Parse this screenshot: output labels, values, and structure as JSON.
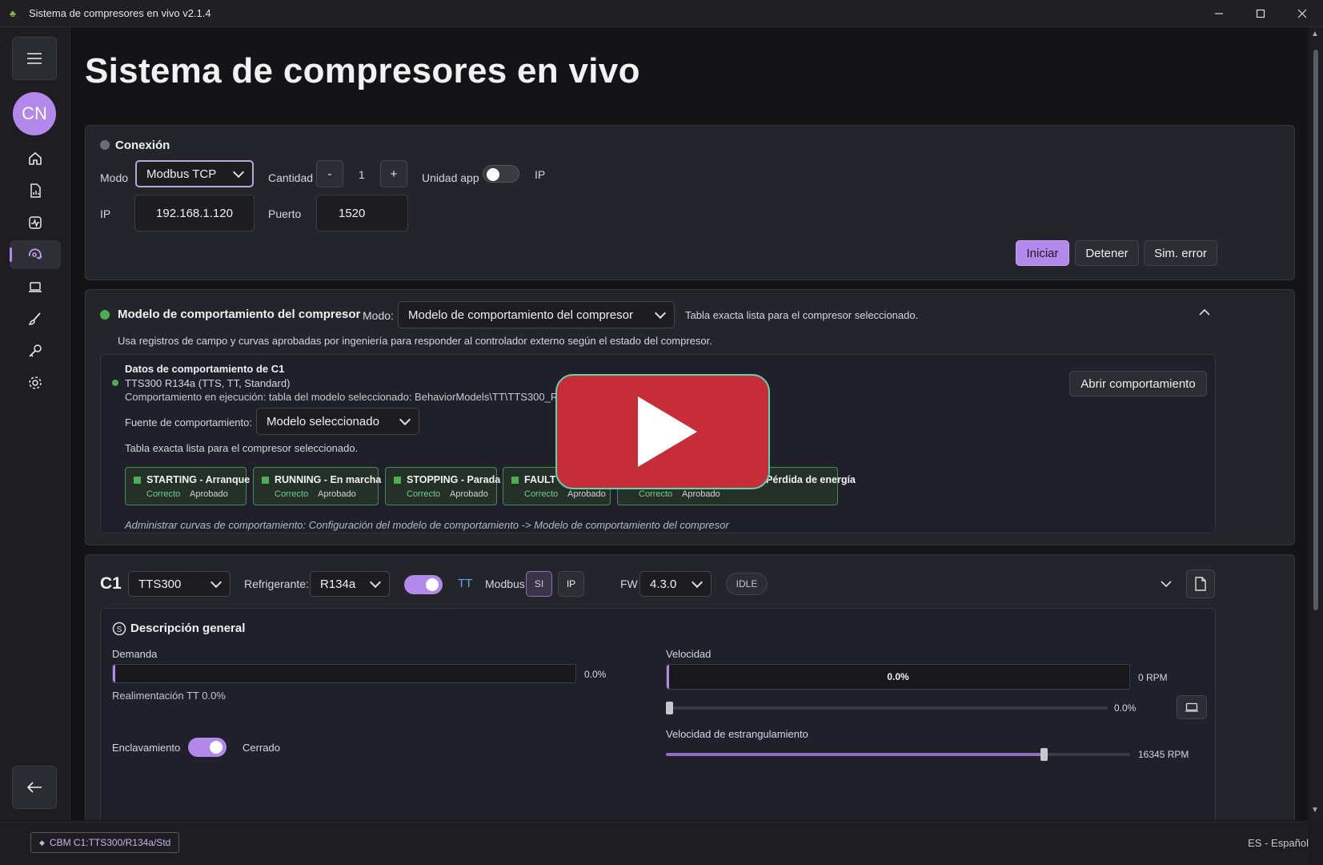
{
  "window": {
    "title": "Sistema de compresores en vivo v2.1.4"
  },
  "sidebar": {
    "avatar_initials": "CN",
    "items": [
      {
        "icon": "home-icon"
      },
      {
        "icon": "report-icon"
      },
      {
        "icon": "activity-icon"
      },
      {
        "icon": "compressor-icon",
        "active": true
      },
      {
        "icon": "laptop-icon"
      },
      {
        "icon": "brush-icon"
      },
      {
        "icon": "key-icon"
      },
      {
        "icon": "gear-icon"
      }
    ]
  },
  "page": {
    "title": "Sistema de compresores en vivo"
  },
  "connection": {
    "header": "Conexión",
    "mode_label": "Modo",
    "mode_value": "Modbus TCP",
    "quantity_label": "Cantidad",
    "quantity_minus": "-",
    "quantity_value": "1",
    "quantity_plus": "+",
    "unit_app_label": "Unidad app",
    "ip_toggle_label": "IP",
    "ip_label": "IP",
    "ip_value": "192.168.1.120",
    "port_label": "Puerto",
    "port_value": "1520",
    "start_button": "Iniciar",
    "stop_button": "Detener",
    "sim_error_button": "Sim. error",
    "status_color": "#6b6b70"
  },
  "behavior": {
    "header": "Modelo de comportamiento del compresor",
    "mode_label": "Modo:",
    "mode_value": "Modelo de comportamiento del compresor",
    "ready_text": "Tabla exacta lista para el compresor seleccionado.",
    "description": "Usa registros de campo y curvas aprobadas por ingeniería para responder al controlador externo según el estado del compresor.",
    "status_color": "#4caf50",
    "data": {
      "title": "Datos de comportamiento de C1",
      "model": "TTS300 R134a (TTS, TT, Standard)",
      "running_text": "Comportamiento en ejecución: tabla del modelo seleccionado: BehaviorModels\\TT\\TTS300_R134a\\behavior-t",
      "source_label": "Fuente de comportamiento:",
      "source_value": "Modelo seleccionado",
      "ready_text": "Tabla exacta lista para el compresor seleccionado.",
      "open_button": "Abrir comportamiento",
      "footer_note": "Administrar curvas de comportamiento: Configuración del modelo de comportamiento -> Modelo de comportamiento del compresor",
      "states": [
        {
          "name": "STARTING - Arranque",
          "status": "Correcto",
          "approval": "Aprobado"
        },
        {
          "name": "RUNNING - En marcha",
          "status": "Correcto",
          "approval": "Aprobado"
        },
        {
          "name": "STOPPING - Parada",
          "status": "Correcto",
          "approval": "Aprobado"
        },
        {
          "name": "FAULT - Fallo",
          "status": "Correcto",
          "approval": "Aprobado"
        },
        {
          "name": "POWER_INTERRUPTING - Pérdida de energía",
          "status": "Correcto",
          "approval": "Aprobado"
        }
      ]
    }
  },
  "compressor": {
    "id": "C1",
    "model": "TTS300",
    "refrigerant_label": "Refrigerante:",
    "refrigerant_value": "R134a",
    "tt_label": "TT",
    "modbus_label": "Modbus",
    "modbus_si": "SI",
    "modbus_ip": "IP",
    "fw_label": "FW",
    "fw_value": "4.3.0",
    "state_badge": "IDLE",
    "overview": {
      "title": "Descripción general",
      "demand_label": "Demanda",
      "demand_value": "0.0%",
      "demand_fraction": 0.0,
      "feedback_text": "Realimentación TT 0.0%",
      "interlock_label": "Enclavamiento",
      "interlock_state": "Cerrado",
      "speed_label": "Velocidad",
      "speed_bar_text": "0.0%",
      "speed_rpm": "0 RPM",
      "speed_slider_value": "0.0%",
      "speed_slider_fraction": 0.0,
      "throttle_label": "Velocidad de estrangulamiento",
      "throttle_value": "16345 RPM",
      "throttle_fraction": 0.81
    }
  },
  "statusbar": {
    "cbm_text": "CBM C1:TTS300/R134a/Std",
    "language": "ES - Español"
  },
  "colors": {
    "accent": "#b388eb",
    "ok": "#4caf50",
    "video_overlay": "#c62d38"
  }
}
